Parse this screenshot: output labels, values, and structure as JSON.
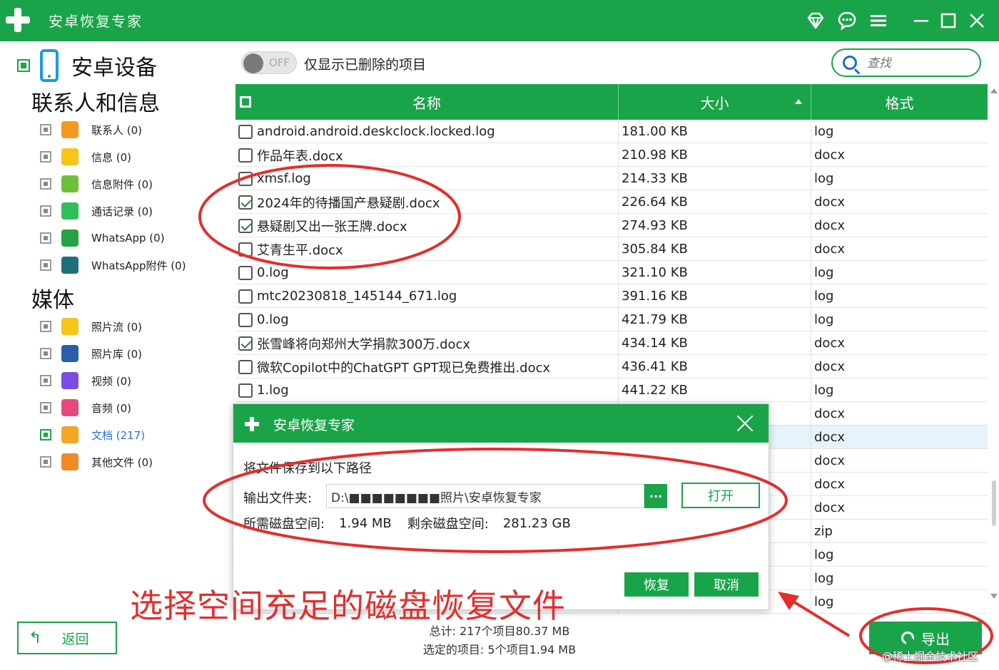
{
  "app": {
    "title": "安卓恢复专家"
  },
  "titlebar_icons": [
    "diamond-icon",
    "chat-icon",
    "menu-icon",
    "minimize-icon",
    "maximize-icon",
    "close-icon"
  ],
  "sidebar": {
    "device_label": "安卓设备",
    "section_contacts": "联系人和信息",
    "section_media": "媒体",
    "contacts_items": [
      {
        "label": "联系人 (0)",
        "icon": "contact-icon",
        "color": "#f29a1f"
      },
      {
        "label": "信息 (0)",
        "icon": "message-icon",
        "color": "#f5c518"
      },
      {
        "label": "信息附件 (0)",
        "icon": "attachment-icon",
        "color": "#6fbf3b"
      },
      {
        "label": "通话记录 (0)",
        "icon": "phone-call-icon",
        "color": "#2fbf5a"
      },
      {
        "label": "WhatsApp (0)",
        "icon": "whatsapp-icon",
        "color": "#25a244"
      },
      {
        "label": "WhatsApp附件 (0)",
        "icon": "whatsapp-attachment-icon",
        "color": "#1f6f7a"
      }
    ],
    "media_items": [
      {
        "label": "照片流 (0)",
        "icon": "star-icon",
        "color": "#f5c518",
        "active": false
      },
      {
        "label": "照片库 (0)",
        "icon": "image-icon",
        "color": "#2a5fa8",
        "active": false
      },
      {
        "label": "视频 (0)",
        "icon": "video-icon",
        "color": "#7a4de0",
        "active": false
      },
      {
        "label": "音频 (0)",
        "icon": "music-icon",
        "color": "#e54a7a",
        "active": false
      },
      {
        "label": "文档 (217)",
        "icon": "document-icon",
        "color": "#f5a623",
        "active": true
      },
      {
        "label": "其他文件 (0)",
        "icon": "other-file-icon",
        "color": "#f08a24",
        "active": false
      }
    ],
    "back_label": "返回"
  },
  "toolbar": {
    "toggle_text": "OFF",
    "toggle_label": "仅显示已删除的项目",
    "search_placeholder": "查找"
  },
  "table": {
    "headers": {
      "name": "名称",
      "size": "大小",
      "format": "格式"
    },
    "rows": [
      {
        "name": "android.android.deskclock.locked.log",
        "size": "181.00 KB",
        "format": "log",
        "checked": false,
        "highlight": false
      },
      {
        "name": "作品年表.docx",
        "size": "210.98 KB",
        "format": "docx",
        "checked": false,
        "highlight": false
      },
      {
        "name": "xmsf.log",
        "size": "214.33 KB",
        "format": "log",
        "checked": false,
        "highlight": false
      },
      {
        "name": "2024年的待播国产悬疑剧.docx",
        "size": "226.64 KB",
        "format": "docx",
        "checked": true,
        "highlight": false
      },
      {
        "name": "悬疑剧又出一张王牌.docx",
        "size": "274.93 KB",
        "format": "docx",
        "checked": true,
        "highlight": false
      },
      {
        "name": "艾青生平.docx",
        "size": "305.84 KB",
        "format": "docx",
        "checked": false,
        "highlight": false
      },
      {
        "name": "0.log",
        "size": "321.10 KB",
        "format": "log",
        "checked": false,
        "highlight": false
      },
      {
        "name": "mtc20230818_145144_671.log",
        "size": "391.16 KB",
        "format": "log",
        "checked": false,
        "highlight": false
      },
      {
        "name": "0.log",
        "size": "421.79 KB",
        "format": "log",
        "checked": false,
        "highlight": false
      },
      {
        "name": "张雪峰将向郑州大学捐款300万.docx",
        "size": "434.14 KB",
        "format": "docx",
        "checked": true,
        "highlight": false
      },
      {
        "name": "微软Copilot中的ChatGPT GPT现已免费推出.docx",
        "size": "436.41 KB",
        "format": "docx",
        "checked": false,
        "highlight": false
      },
      {
        "name": "1.log",
        "size": "441.22 KB",
        "format": "log",
        "checked": false,
        "highlight": false
      },
      {
        "name": "",
        "size": "",
        "format": "docx",
        "checked": false,
        "highlight": false
      },
      {
        "name": "",
        "size": "",
        "format": "docx",
        "checked": false,
        "highlight": true
      },
      {
        "name": "",
        "size": "",
        "format": "docx",
        "checked": false,
        "highlight": false
      },
      {
        "name": "",
        "size": "",
        "format": "docx",
        "checked": false,
        "highlight": false
      },
      {
        "name": "",
        "size": "",
        "format": "docx",
        "checked": false,
        "highlight": false
      },
      {
        "name": "",
        "size": "",
        "format": "zip",
        "checked": false,
        "highlight": false
      },
      {
        "name": "",
        "size": "",
        "format": "log",
        "checked": false,
        "highlight": false
      },
      {
        "name": "",
        "size": "",
        "format": "log",
        "checked": false,
        "highlight": false
      },
      {
        "name": "",
        "size": "",
        "format": "log",
        "checked": false,
        "highlight": false
      }
    ]
  },
  "dialog": {
    "title": "安卓恢复专家",
    "prompt": "将文件保存到以下路径",
    "output_label": "输出文件夹:",
    "output_path": "D:\\■■■■■■■■照片\\安卓恢复专家",
    "dots_label": "···",
    "open_label": "打开",
    "required_label": "所需磁盘空间:",
    "required_value": "1.94 MB",
    "free_label": "剩余磁盘空间:",
    "free_value": "281.23 GB",
    "recover_label": "恢复",
    "cancel_label": "取消"
  },
  "footer": {
    "total": "总计: 217个项目80.37 MB",
    "selected": "选定的项目: 5个项目1.94 MB",
    "export_label": "导出"
  },
  "annotation": {
    "caption": "选择空间充足的磁盘恢复文件",
    "color": "#e42e2e"
  },
  "watermark": "@稀土掘金技术社区",
  "colors": {
    "brand_green": "#1aa44a",
    "active_blue": "#2b6fd6"
  }
}
